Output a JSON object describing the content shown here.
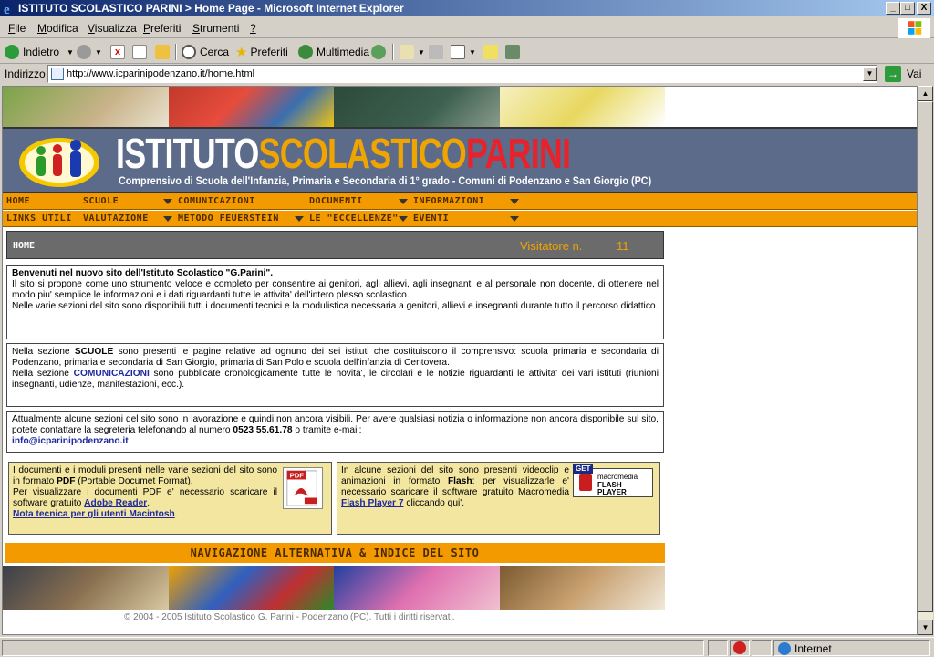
{
  "window": {
    "title": "ISTITUTO SCOLASTICO PARINI > Home Page - Microsoft Internet Explorer",
    "minimize": "_",
    "maximize": "□",
    "close": "X"
  },
  "menu": [
    {
      "ul": "F",
      "rest": "ile"
    },
    {
      "ul": "M",
      "rest": "odifica"
    },
    {
      "ul": "V",
      "rest": "isualizza"
    },
    {
      "ul": "P",
      "rest": "referiti"
    },
    {
      "ul": "S",
      "rest": "trumenti"
    },
    {
      "ul": "?",
      "rest": ""
    }
  ],
  "toolbar": {
    "back": "Indietro",
    "search": "Cerca",
    "favorites": "Preferiti",
    "media": "Multimedia"
  },
  "address": {
    "label": "Indirizzo",
    "url": "http://www.icparinipodenzano.it/home.html",
    "go": "Vai"
  },
  "banner": {
    "title_white": "ISTITUTO",
    "title_orange": "SCOLASTICO",
    "title_red": "PARINI",
    "subtitle": "Comprensivo di Scuola dell'Infanzia, Primaria e Secondaria di 1° grado  - Comuni di Podenzano e San Giorgio (PC)"
  },
  "nav_row1": [
    "HOME",
    "SCUOLE",
    "COMUNICAZIONI",
    "DOCUMENTI",
    "INFORMAZIONI"
  ],
  "nav_row2": [
    "LINKS UTILI",
    "VALUTAZIONE",
    "METODO FEUERSTEIN",
    "LE \"ECCELLENZE\"",
    "EVENTI"
  ],
  "home_bar": {
    "label": "HOME",
    "visitors_label": "Visitatore n.",
    "visitors_count": "11"
  },
  "intro": {
    "heading": "Benvenuti nel nuovo sito dell'Istituto Scolastico \"G.Parini\".",
    "p1": "Il sito si propone come uno strumento veloce e completo per consentire ai genitori, agli allievi, agli insegnanti e al personale non docente, di ottenere nel modo piu' semplice le informazioni e i dati riguardanti tutte le attivita' dell'intero plesso scolastico.",
    "p2": "Nelle varie sezioni del sito sono disponibili tutti i documenti tecnici e la modulistica necessaria a genitori, allievi e insegnanti durante tutto il percorso didattico."
  },
  "sections": {
    "s1_a": "Nella sezione ",
    "s1_key": "SCUOLE",
    "s1_b": " sono presenti le pagine relative ad ognuno dei sei istituti che costituiscono il comprensivo: scuola primaria e secondaria di Podenzano, primaria e secondaria di San Giorgio, primaria di San Polo e scuola dell'infanzia di Centovera.",
    "s2_a": "Nella sezione ",
    "s2_key": "COMUNICAZIONI",
    "s2_b": " sono pubblicate cronologicamente tutte le novita', le circolari e le notizie riguardanti le attivita' dei vari istituti (riunioni insegnanti, udienze, manifestazioni, ecc.)."
  },
  "notice": {
    "text": "Attualmente alcune sezioni del sito sono in lavorazione e quindi non ancora visibili. Per avere qualsiasi notizia o informazione non ancora disponibile sul sito, potete contattare la segreteria telefonando al numero ",
    "phone": "0523 55.61.78",
    "mid": " o tramite e-mail:",
    "email": "info@icparinipodenzano.it"
  },
  "pdf_box": {
    "t1": "I documenti e i moduli presenti nelle varie sezioni del sito sono in formato ",
    "pdf": "PDF",
    "t2": " (Portable Documet Format).",
    "t3": "Per visualizzare i documenti PDF e' necessario scaricare il software gratuito ",
    "reader": "Adobe Reader",
    "t4": ".",
    "mac": "Nota tecnica per gli utenti Macintosh",
    "t5": "."
  },
  "flash_box": {
    "t1": "In alcune sezioni del sito sono presenti videoclip e animazioni in formato ",
    "flash": "Flash",
    "t2": ": per visualizzarle e' necessario scaricare il software gratuito Macromedia ",
    "player": "Flash Player 7",
    "t3": " cliccando qui'.",
    "badge_get": "GET",
    "badge_mm": "macromedia",
    "badge_fp1": "FLASH",
    "badge_fp2": "PLAYER"
  },
  "alt_nav": "NAVIGAZIONE ALTERNATIVA & INDICE DEL SITO",
  "footer": "© 2004 - 2005 Istituto Scolastico G. Parini - Podenzano (PC). Tutti i diritti riservati.",
  "status": {
    "zone": "Internet"
  },
  "colors": {
    "nav_orange": "#f39a00",
    "banner_blue": "#5c6b8a",
    "title_orange": "#f0a400",
    "title_red": "#e8222a",
    "box_yellow": "#f2e6a0",
    "link_blue": "#1f2aa0"
  }
}
